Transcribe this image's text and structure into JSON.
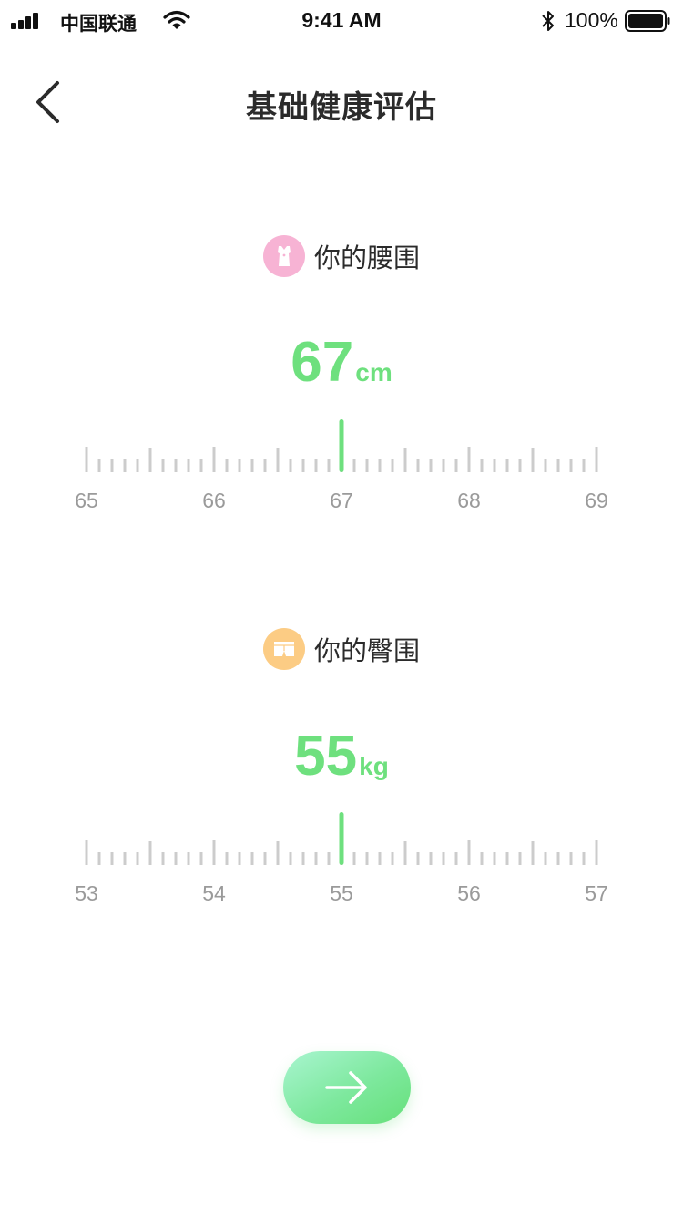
{
  "status_bar": {
    "carrier": "中国联通",
    "time": "9:41 AM",
    "battery": "100%"
  },
  "header": {
    "title": "基础健康评估",
    "back_icon": "chevron-left-icon"
  },
  "waist": {
    "label": "你的腰围",
    "icon": "dress-icon",
    "icon_color": "#f7b3d4",
    "value": "67",
    "unit": "cm",
    "ticks": [
      "65",
      "66",
      "67",
      "68",
      "69"
    ],
    "current": 67
  },
  "hip": {
    "label": "你的臀围",
    "icon": "shorts-icon",
    "icon_color": "#fccc84",
    "value": "55",
    "unit": "kg",
    "ticks": [
      "53",
      "54",
      "55",
      "56",
      "57"
    ],
    "current": 55
  },
  "next_button": {
    "icon": "arrow-right-icon"
  },
  "colors": {
    "accent": "#6ee07e",
    "tick": "#cccccc",
    "tick_label": "#9a9a9a"
  }
}
